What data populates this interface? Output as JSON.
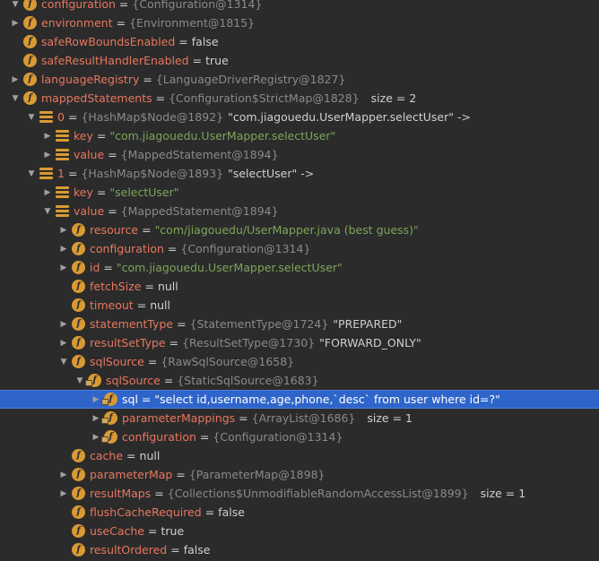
{
  "rows": [
    {
      "depth": 0,
      "arrow": "down",
      "icon": "field",
      "name": "configuration",
      "type": "{Configuration@1314}",
      "top": true
    },
    {
      "depth": 0,
      "arrow": "right",
      "icon": "field",
      "name": "environment",
      "type": "{Environment@1815}"
    },
    {
      "depth": 0,
      "arrow": "none",
      "icon": "field",
      "name": "safeRowBoundsEnabled",
      "value": "false"
    },
    {
      "depth": 0,
      "arrow": "none",
      "icon": "field",
      "name": "safeResultHandlerEnabled",
      "value": "true"
    },
    {
      "depth": 0,
      "arrow": "right",
      "icon": "field",
      "name": "languageRegistry",
      "type": "{LanguageDriverRegistry@1827}"
    },
    {
      "depth": 0,
      "arrow": "down",
      "icon": "field",
      "name": "mappedStatements",
      "type": "{Configuration$StrictMap@1828}",
      "size": "size = 2"
    },
    {
      "depth": 1,
      "arrow": "down",
      "icon": "entry",
      "name": "0",
      "type": "{HashMap$Node@1892}",
      "value": "\"com.jiagouedu.UserMapper.selectUser\" ->"
    },
    {
      "depth": 2,
      "arrow": "right",
      "icon": "entry",
      "name": "key",
      "str": "\"com.jiagouedu.UserMapper.selectUser\""
    },
    {
      "depth": 2,
      "arrow": "right",
      "icon": "entry",
      "name": "value",
      "type": "{MappedStatement@1894}"
    },
    {
      "depth": 1,
      "arrow": "down",
      "icon": "entry",
      "name": "1",
      "type": "{HashMap$Node@1893}",
      "value": "\"selectUser\" ->"
    },
    {
      "depth": 2,
      "arrow": "right",
      "icon": "entry",
      "name": "key",
      "str": "\"selectUser\""
    },
    {
      "depth": 2,
      "arrow": "down",
      "icon": "entry",
      "name": "value",
      "type": "{MappedStatement@1894}"
    },
    {
      "depth": 3,
      "arrow": "right",
      "icon": "field",
      "name": "resource",
      "str": "\"com/jiagouedu/UserMapper.java (best guess)\""
    },
    {
      "depth": 3,
      "arrow": "right",
      "icon": "field",
      "name": "configuration",
      "type": "{Configuration@1314}"
    },
    {
      "depth": 3,
      "arrow": "right",
      "icon": "field",
      "name": "id",
      "str": "\"com.jiagouedu.UserMapper.selectUser\""
    },
    {
      "depth": 3,
      "arrow": "none",
      "icon": "field",
      "name": "fetchSize",
      "value": "null"
    },
    {
      "depth": 3,
      "arrow": "none",
      "icon": "field",
      "name": "timeout",
      "value": "null"
    },
    {
      "depth": 3,
      "arrow": "right",
      "icon": "field",
      "name": "statementType",
      "type": "{StatementType@1724}",
      "value": "\"PREPARED\""
    },
    {
      "depth": 3,
      "arrow": "right",
      "icon": "field",
      "name": "resultSetType",
      "type": "{ResultSetType@1730}",
      "value": "\"FORWARD_ONLY\""
    },
    {
      "depth": 3,
      "arrow": "down",
      "icon": "field",
      "name": "sqlSource",
      "type": "{RawSqlSource@1658}"
    },
    {
      "depth": 4,
      "arrow": "down",
      "icon": "field-locked",
      "name": "sqlSource",
      "type": "{StaticSqlSource@1683}"
    },
    {
      "depth": 5,
      "arrow": "right",
      "icon": "field-locked",
      "name": "sql",
      "value": "\"select id,username,age,phone,`desc` from user where id=?\"",
      "selected": true
    },
    {
      "depth": 5,
      "arrow": "right",
      "icon": "field-locked",
      "name": "parameterMappings",
      "type": "{ArrayList@1686}",
      "size": "size = 1"
    },
    {
      "depth": 5,
      "arrow": "right",
      "icon": "field-locked",
      "name": "configuration",
      "type": "{Configuration@1314}"
    },
    {
      "depth": 3,
      "arrow": "none",
      "icon": "field",
      "name": "cache",
      "value": "null"
    },
    {
      "depth": 3,
      "arrow": "right",
      "icon": "field",
      "name": "parameterMap",
      "type": "{ParameterMap@1898}"
    },
    {
      "depth": 3,
      "arrow": "right",
      "icon": "field",
      "name": "resultMaps",
      "type": "{Collections$UnmodifiableRandomAccessList@1899}",
      "size": "size = 1"
    },
    {
      "depth": 3,
      "arrow": "none",
      "icon": "field",
      "name": "flushCacheRequired",
      "value": "false"
    },
    {
      "depth": 3,
      "arrow": "none",
      "icon": "field",
      "name": "useCache",
      "value": "true"
    },
    {
      "depth": 3,
      "arrow": "none",
      "icon": "field",
      "name": "resultOrdered",
      "value": "false"
    }
  ]
}
